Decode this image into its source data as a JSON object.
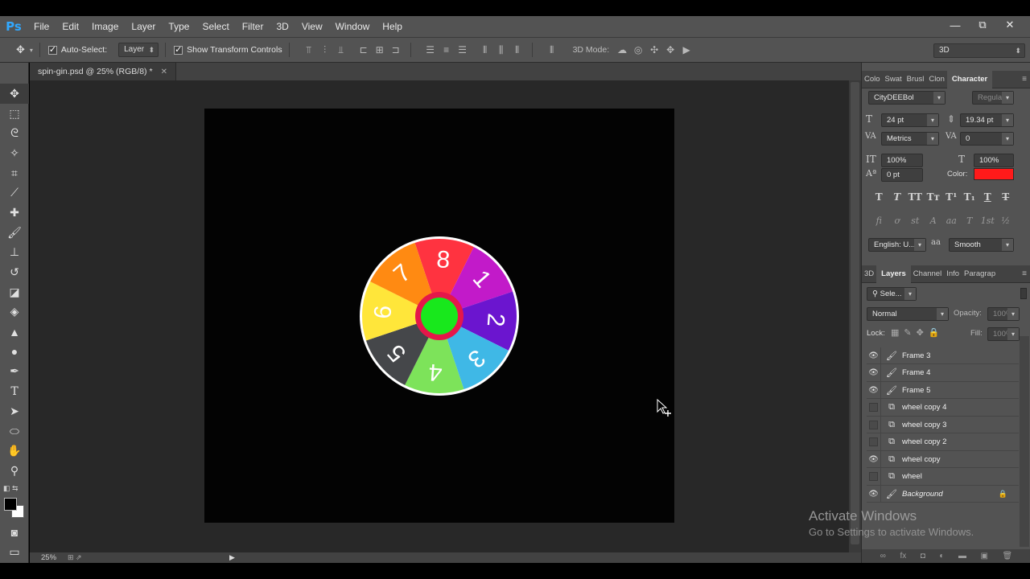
{
  "app": {
    "logo": "Ps"
  },
  "menu": [
    "File",
    "Edit",
    "Image",
    "Layer",
    "Type",
    "Select",
    "Filter",
    "3D",
    "View",
    "Window",
    "Help"
  ],
  "window_controls": [
    "—",
    "⧉",
    "✕"
  ],
  "options": {
    "auto_select_label": "Auto-Select:",
    "auto_select_checked": true,
    "auto_select_value": "Layer",
    "show_transform_label": "Show Transform Controls",
    "show_transform_checked": true,
    "mode_3d_label": "3D Mode:",
    "workspace_value": "3D"
  },
  "document": {
    "tab_title": "spin-gin.psd @ 25% (RGB/8) *",
    "canvas_color": "#030303"
  },
  "wheel": {
    "numbers": [
      "8",
      "1",
      "2",
      "3",
      "4",
      "5",
      "6",
      "7"
    ],
    "segment_colors": [
      "#ff3340",
      "#c21ac9",
      "#6b15cf",
      "#3fb8e6",
      "#7de35a",
      "#45474a",
      "#ffe63a",
      "#ff8a12"
    ],
    "center_color": "#18e81c",
    "center_ring_color": "#e5174a",
    "rim_color": "#ffffff"
  },
  "status": {
    "zoom": "25%"
  },
  "character_panel": {
    "tabs": [
      "Colo",
      "Swat",
      "Brusl",
      "Clon",
      "Character"
    ],
    "active_tab": "Character",
    "font_family": "CityDEEBol",
    "font_style": "Regular",
    "font_size": "24 pt",
    "leading": "19.34 pt",
    "kerning": "Metrics",
    "tracking": "0",
    "vertical_scale": "100%",
    "horizontal_scale": "100%",
    "baseline_shift": "0 pt",
    "color_label": "Color:",
    "color_value": "#ff1a1a",
    "language": "English: U...",
    "antialias_icon": "aa",
    "antialias": "Smooth",
    "style_buttons": [
      "T",
      "T",
      "TT",
      "Tт",
      "T¹",
      "T₁",
      "T",
      "T"
    ],
    "opentype_buttons": [
      "fi",
      "ơ",
      "st",
      "A",
      "aa",
      "T",
      "1st",
      "½"
    ]
  },
  "layers_panel": {
    "tabs": [
      "3D",
      "Layers",
      "Channel",
      "Info",
      "Paragrap"
    ],
    "active_tab": "Layers",
    "filter_label": "Sele...",
    "blend_mode": "Normal",
    "opacity_label": "Opacity:",
    "opacity_value": "100%",
    "lock_label": "Lock:",
    "fill_label": "Fill:",
    "fill_value": "100%",
    "layers": [
      {
        "name": "Frame 3",
        "visible": true,
        "type": "brush",
        "italic": false,
        "locked": false
      },
      {
        "name": "Frame 4",
        "visible": true,
        "type": "brush",
        "italic": false,
        "locked": false
      },
      {
        "name": "Frame 5",
        "visible": true,
        "type": "brush",
        "italic": false,
        "locked": false
      },
      {
        "name": "wheel copy 4",
        "visible": false,
        "type": "smart",
        "italic": false,
        "locked": false
      },
      {
        "name": "wheel copy 3",
        "visible": false,
        "type": "smart",
        "italic": false,
        "locked": false
      },
      {
        "name": "wheel copy 2",
        "visible": false,
        "type": "smart",
        "italic": false,
        "locked": false
      },
      {
        "name": "wheel copy",
        "visible": true,
        "type": "smart",
        "italic": false,
        "locked": false
      },
      {
        "name": "wheel",
        "visible": false,
        "type": "smart",
        "italic": false,
        "locked": false
      },
      {
        "name": "Background",
        "visible": true,
        "type": "brush",
        "italic": true,
        "locked": true
      }
    ]
  },
  "watermark": {
    "title": "Activate Windows",
    "subtitle": "Go to Settings to activate Windows."
  }
}
